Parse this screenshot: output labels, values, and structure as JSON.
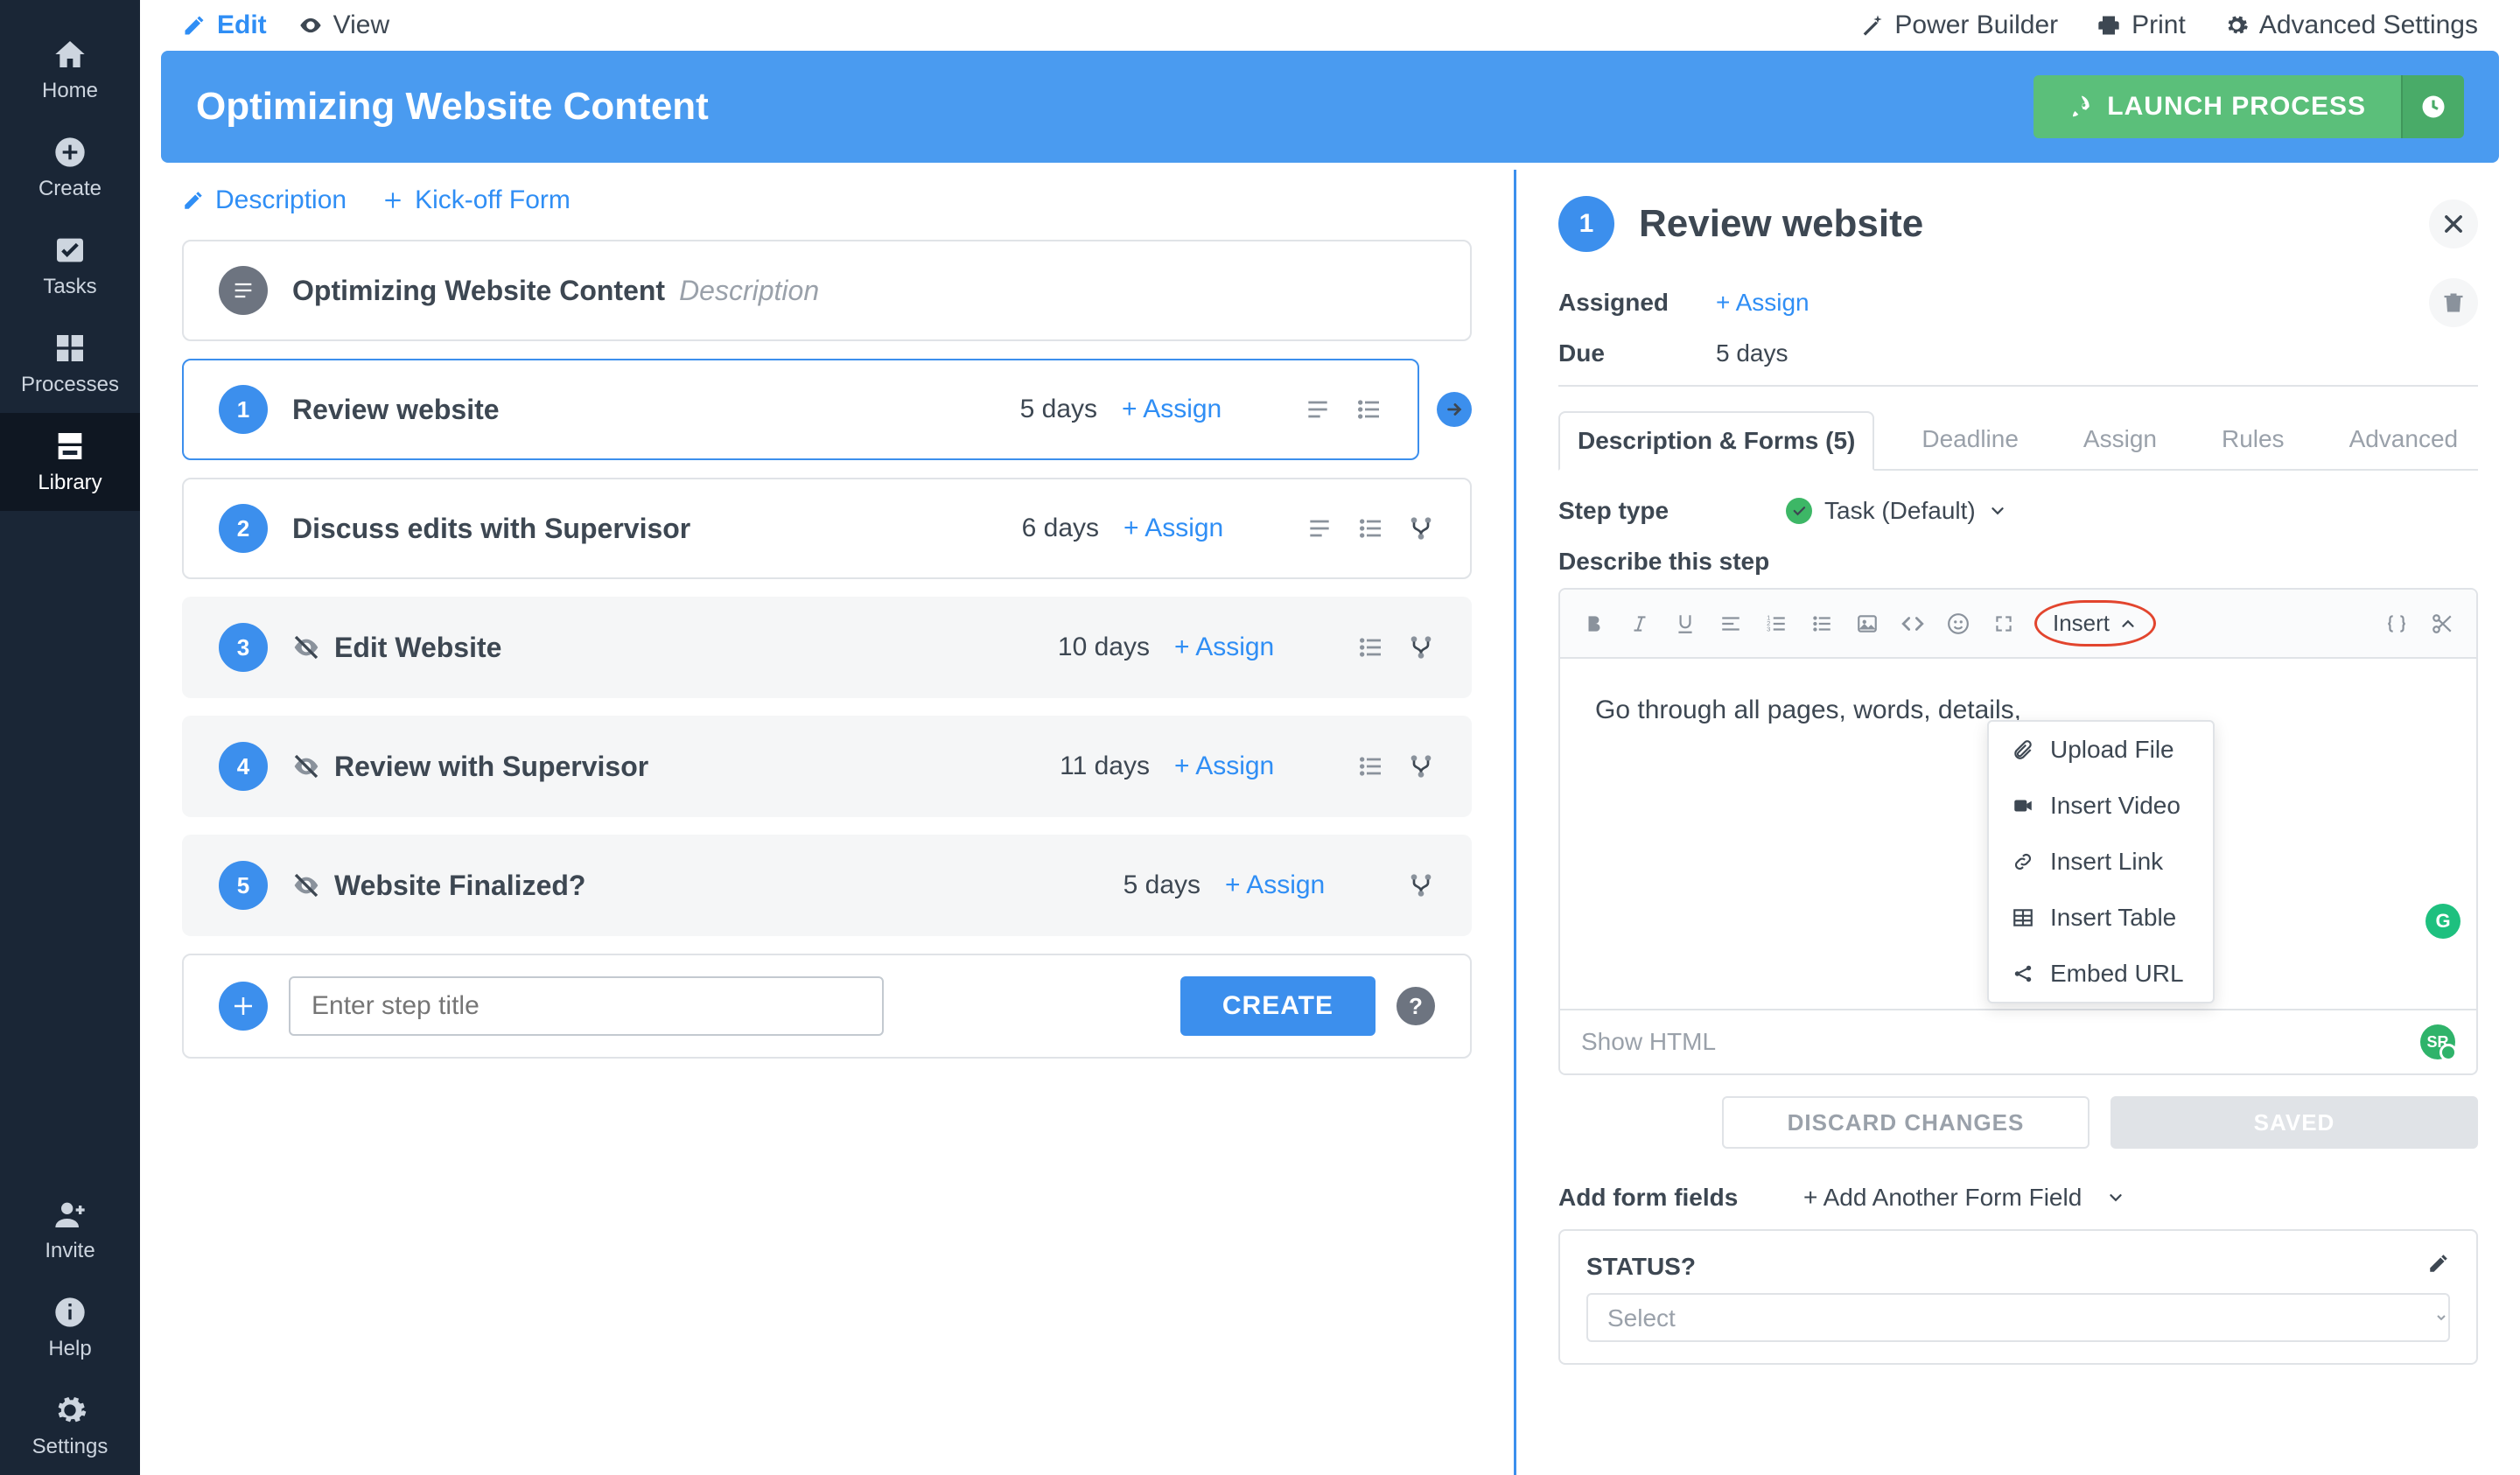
{
  "rail": {
    "items": [
      {
        "label": "Home"
      },
      {
        "label": "Create"
      },
      {
        "label": "Tasks"
      },
      {
        "label": "Processes"
      },
      {
        "label": "Library"
      }
    ],
    "bottom": [
      {
        "label": "Invite"
      },
      {
        "label": "Help"
      },
      {
        "label": "Settings"
      }
    ]
  },
  "topbar": {
    "edit": "Edit",
    "view": "View",
    "power_builder": "Power Builder",
    "print": "Print",
    "advanced": "Advanced Settings"
  },
  "banner": {
    "title": "Optimizing Website Content",
    "launch": "LAUNCH PROCESS"
  },
  "builder_tabs": {
    "description": "Description",
    "kickoff": "Kick-off Form"
  },
  "process_header": {
    "title": "Optimizing Website Content",
    "hint": "Description"
  },
  "steps": [
    {
      "n": "1",
      "title": "Review website",
      "deadline": "5 days",
      "assign": "+ Assign",
      "hidden": false,
      "icons": [
        "lines",
        "list"
      ]
    },
    {
      "n": "2",
      "title": "Discuss edits with Supervisor",
      "deadline": "6 days",
      "assign": "+ Assign",
      "hidden": false,
      "icons": [
        "lines",
        "list",
        "branch"
      ]
    },
    {
      "n": "3",
      "title": "Edit Website",
      "deadline": "10 days",
      "assign": "+ Assign",
      "hidden": true,
      "icons": [
        "list",
        "branch"
      ]
    },
    {
      "n": "4",
      "title": "Review with Supervisor",
      "deadline": "11 days",
      "assign": "+ Assign",
      "hidden": true,
      "icons": [
        "list",
        "branch"
      ]
    },
    {
      "n": "5",
      "title": "Website Finalized?",
      "deadline": "5 days",
      "assign": "+ Assign",
      "hidden": true,
      "icons": [
        "branch"
      ]
    }
  ],
  "new_step": {
    "placeholder": "Enter step title",
    "create": "CREATE"
  },
  "detail": {
    "n": "1",
    "title": "Review website",
    "assigned_label": "Assigned",
    "assign_link": "+ Assign",
    "due_label": "Due",
    "due_value": "5 days",
    "tabs": {
      "desc": "Description & Forms (5)",
      "deadline": "Deadline",
      "assign": "Assign",
      "rules": "Rules",
      "advanced": "Advanced"
    },
    "step_type_label": "Step type",
    "step_type_value": "Task (Default)",
    "describe_label": "Describe this step",
    "editor_text": "Go through all pages, words, details,",
    "show_html": "Show HTML",
    "discard": "DISCARD CHANGES",
    "saved": "SAVED",
    "toolbar_insert": "Insert",
    "insert_menu": [
      "Upload File",
      "Insert Video",
      "Insert Link",
      "Insert Table",
      "Embed URL"
    ],
    "ff_label": "Add form fields",
    "ff_add": "+ Add Another Form Field",
    "ff_name": "STATUS?",
    "ff_select_placeholder": "Select",
    "sr_initials": "SR",
    "grammarly": "G"
  }
}
